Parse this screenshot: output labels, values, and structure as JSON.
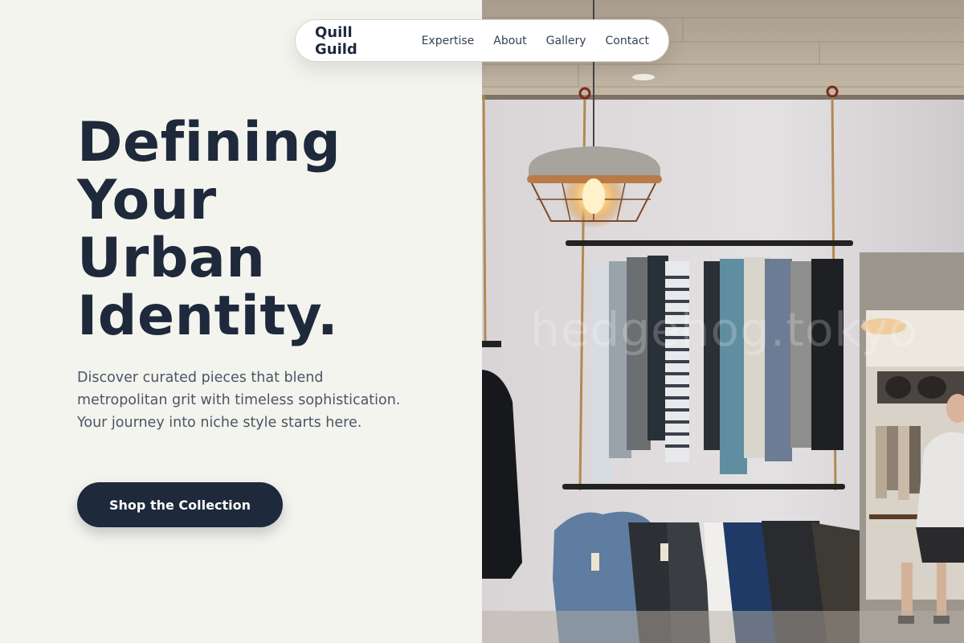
{
  "nav": {
    "brand": "Quill Guild",
    "links": [
      "Expertise",
      "About",
      "Gallery",
      "Contact"
    ]
  },
  "hero": {
    "title_lines": [
      "Defining",
      "Your",
      "Urban",
      "Identity."
    ],
    "description": "Discover curated pieces that blend metropolitan grit with timeless sophistication. Your journey into niche style starts here.",
    "cta_label": "Shop the Collection"
  },
  "image": {
    "watermark": "hedgehog.tokyo"
  },
  "colors": {
    "ink": "#1e293b",
    "background": "#f4f4ef",
    "body_text": "#4b5563"
  }
}
